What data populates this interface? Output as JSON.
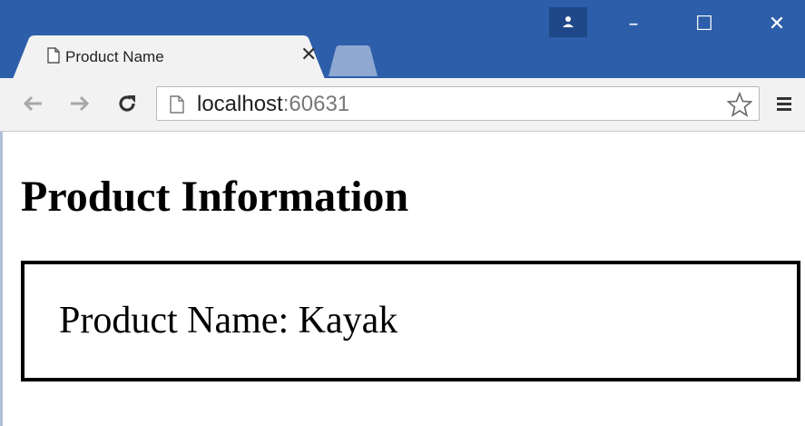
{
  "browser": {
    "tab": {
      "title": "Product Name",
      "close_label": "✕"
    },
    "window_controls": {
      "minimize": "–",
      "maximize": "☐",
      "close": "✕"
    },
    "address": {
      "host": "localhost",
      "port": ":60631"
    },
    "icons": {
      "back": "back-arrow-icon",
      "forward": "forward-arrow-icon",
      "reload": "reload-icon",
      "page": "page-icon",
      "star": "star-icon",
      "menu": "menu-icon",
      "user": "user-icon"
    },
    "colors": {
      "titlebar": "#2d5ea9",
      "toolbar": "#f2f2f2"
    }
  },
  "page": {
    "heading": "Product Information",
    "product_label": "Product Name:",
    "product_value": "Kayak"
  }
}
